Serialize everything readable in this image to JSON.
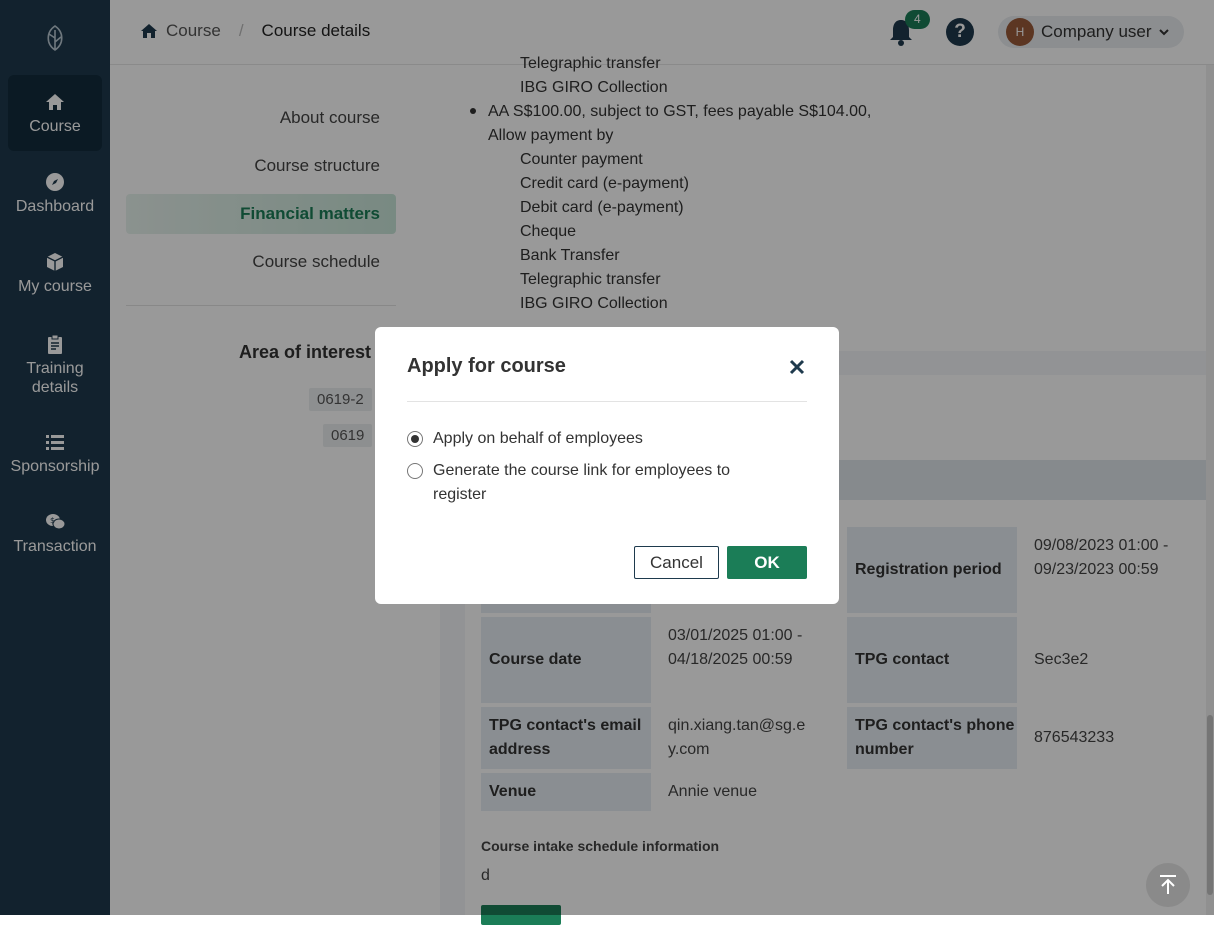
{
  "sidebar": {
    "items": [
      {
        "label": "Course",
        "icon": "home-icon"
      },
      {
        "label": "Dashboard",
        "icon": "compass-icon"
      },
      {
        "label": "My course",
        "icon": "cube-icon"
      },
      {
        "label": "Training\ndetails",
        "icon": "clipboard-icon"
      },
      {
        "label": "Sponsorship",
        "icon": "list-icon"
      },
      {
        "label": "Transaction",
        "icon": "chat-dollar-icon"
      }
    ]
  },
  "header": {
    "breadcrumb": [
      "Course",
      "Course details"
    ],
    "notification_count": "4",
    "user_initial": "H",
    "user_name": "Company user"
  },
  "leftnav": {
    "items": [
      "About course",
      "Course structure",
      "Financial matters",
      "Course schedule"
    ],
    "area_title": "Area of interest",
    "tags": [
      "0619-2",
      "0619"
    ]
  },
  "financial": {
    "top_lines": [
      "Telegraphic transfer",
      "IBG GIRO Collection"
    ],
    "fee_line": "AA S$100.00, subject to GST, fees payable S$104.00,",
    "allow_label": "Allow payment by",
    "methods": [
      "Counter payment",
      "Credit card (e-payment)",
      "Debit card (e-payment)",
      "Cheque",
      "Bank Transfer",
      "Telegraphic transfer",
      "IBG GIRO Collection"
    ]
  },
  "details": {
    "registration_period_label": "Registration period",
    "registration_period_value": "09/08/2023 01:00 - 09/23/2023 00:59",
    "course_date_label": "Course date",
    "course_date_value": "03/01/2025 01:00 - 04/18/2025 00:59",
    "tpg_contact_label": "TPG contact",
    "tpg_contact_value": "Sec3e2",
    "tpg_email_label": "TPG contact's email address",
    "tpg_email_value": "qin.xiang.tan@sg.ey.com",
    "tpg_phone_label": "TPG contact's phone number",
    "tpg_phone_value": "876543233",
    "venue_label": "Venue",
    "venue_value": "Annie venue",
    "schedule_label": "Course intake schedule information",
    "schedule_value": "d"
  },
  "modal": {
    "title": "Apply for course",
    "options": [
      "Apply on behalf of employees",
      "Generate the course link for employees to register"
    ],
    "selected_index": 0,
    "cancel_label": "Cancel",
    "ok_label": "OK"
  },
  "colors": {
    "sidebar": "#1e3a4d",
    "accent": "#1b7d57"
  }
}
